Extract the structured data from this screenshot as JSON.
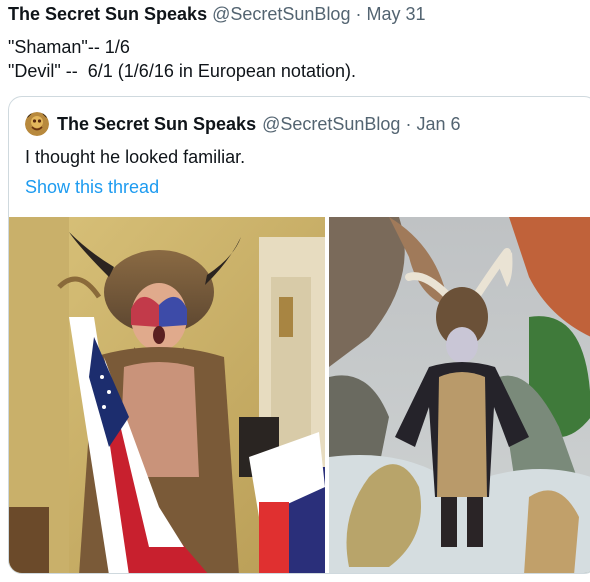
{
  "tweet": {
    "author_name": "The Secret Sun Speaks",
    "author_handle": "@SecretSunBlog",
    "separator": "·",
    "date": "May 31",
    "lines": [
      "\"Shaman\"-- 1/6",
      "\"Devil\" --  6/1 (1/6/16 in European notation)."
    ]
  },
  "quoted": {
    "author_name": "The Secret Sun Speaks",
    "author_handle": "@SecretSunBlog",
    "separator": "·",
    "date": "Jan 6",
    "text": "I thought he looked familiar.",
    "show_thread": "Show this thread",
    "avatar_icon": "avatar-image",
    "media": [
      {
        "description_icon": "photo-shaman"
      },
      {
        "description_icon": "photo-devil-costume"
      }
    ]
  },
  "colors": {
    "text": "#0f1419",
    "muted": "#536471",
    "link": "#1d9bf0",
    "border": "#cfd9de"
  }
}
